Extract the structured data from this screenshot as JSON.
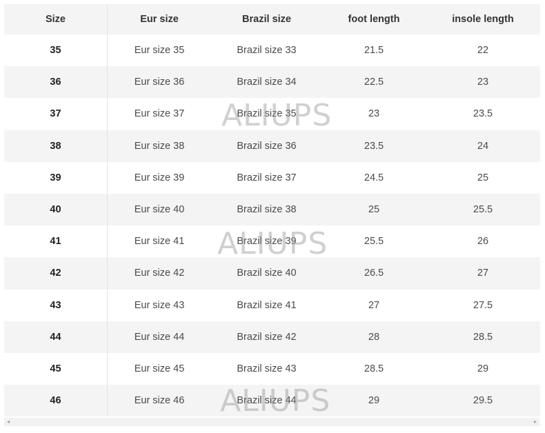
{
  "headers": [
    "Size",
    "Eur size",
    "Brazil size",
    "foot length",
    "insole length"
  ],
  "rows": [
    [
      "35",
      "Eur size 35",
      "Brazil size 33",
      "21.5",
      "22"
    ],
    [
      "36",
      "Eur size 36",
      "Brazil size 34",
      "22.5",
      "23"
    ],
    [
      "37",
      "Eur size 37",
      "Brazil size 35",
      "23",
      "23.5"
    ],
    [
      "38",
      "Eur size 38",
      "Brazil size 36",
      "23.5",
      "24"
    ],
    [
      "39",
      "Eur size 39",
      "Brazil size 37",
      "24.5",
      "25"
    ],
    [
      "40",
      "Eur size 40",
      "Brazil size 38",
      "25",
      "25.5"
    ],
    [
      "41",
      "Eur size 41",
      "Brazil size 39",
      "25.5",
      "26"
    ],
    [
      "42",
      "Eur size 42",
      "Brazil size 40",
      "26.5",
      "27"
    ],
    [
      "43",
      "Eur size 43",
      "Brazil size 41",
      "27",
      "27.5"
    ],
    [
      "44",
      "Eur size 44",
      "Brazil size 42",
      "28",
      "28.5"
    ],
    [
      "45",
      "Eur size 45",
      "Brazil size 43",
      "28.5",
      "29"
    ],
    [
      "46",
      "Eur size 46",
      "Brazil size 44",
      "29",
      "29.5"
    ]
  ],
  "watermark": "ALIUPS",
  "scrollbar": {
    "left_arrow_icon": "chevron-left-icon",
    "right_arrow_icon": "chevron-right-icon"
  },
  "colors": {
    "header_bg": "#f4f4f4",
    "stripe_bg": "#f4f4f4",
    "text": "#333333"
  }
}
